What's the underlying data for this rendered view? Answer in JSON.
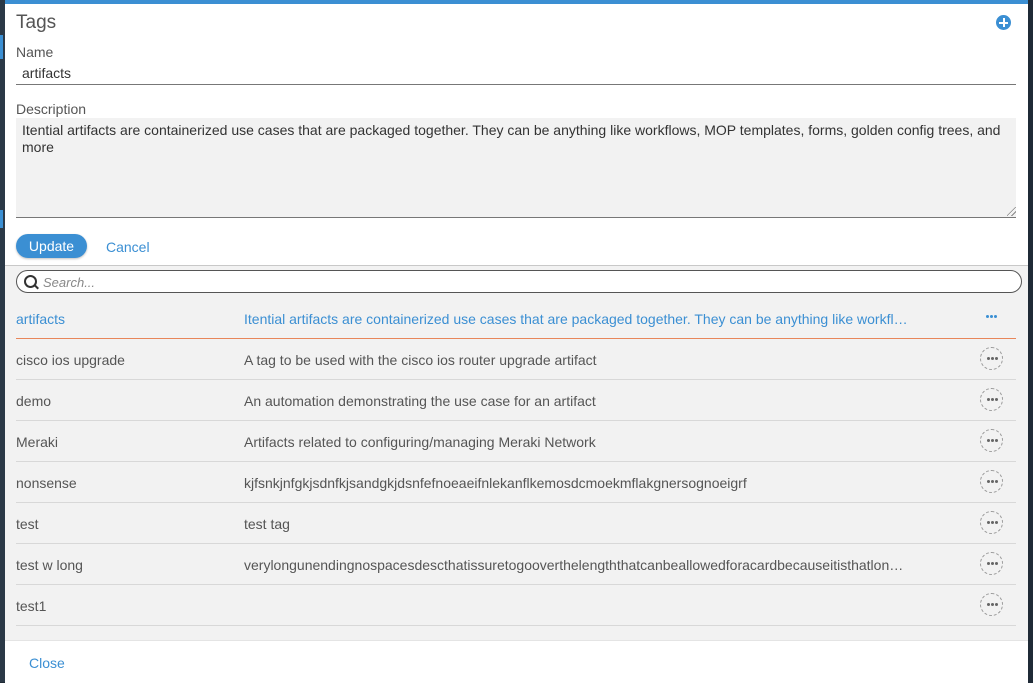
{
  "dialog": {
    "title": "Tags",
    "add_icon": "plus-circle-icon"
  },
  "form": {
    "name_label": "Name",
    "name_value": "artifacts",
    "description_label": "Description",
    "description_value": "Itential artifacts are containerized use cases that are packaged together. They can be anything like workflows, MOP templates, forms, golden config trees, and more",
    "update_label": "Update",
    "cancel_label": "Cancel"
  },
  "search": {
    "placeholder": "Search..."
  },
  "tags": [
    {
      "name": "artifacts",
      "description": "Itential artifacts are containerized use cases that are packaged together. They can be anything like workflows, MOP templates, forms, golden config trees, and more"
    },
    {
      "name": "cisco ios upgrade",
      "description": "A tag to be used with the cisco ios router upgrade artifact"
    },
    {
      "name": "demo",
      "description": "An automation demonstrating the use case for an artifact"
    },
    {
      "name": "Meraki",
      "description": "Artifacts related to configuring/managing Meraki Network"
    },
    {
      "name": "nonsense",
      "description": "kjfsnkjnfgkjsdnfkjsandgkjdsnfefnoeaeifnlekanflkemosdcmoekmflakgnersognoeigrf"
    },
    {
      "name": "test",
      "description": "test tag"
    },
    {
      "name": "test w long",
      "description": "verylongunendingnospacesdescthatissuretogooverthelengththatcanbeallowedforacardbecauseitisthatlongandkeepsgoing"
    },
    {
      "name": "test1",
      "description": ""
    }
  ],
  "footer": {
    "close_label": "Close"
  },
  "colors": {
    "accent": "#3b8fd3",
    "selected_underline": "#e8865a"
  }
}
